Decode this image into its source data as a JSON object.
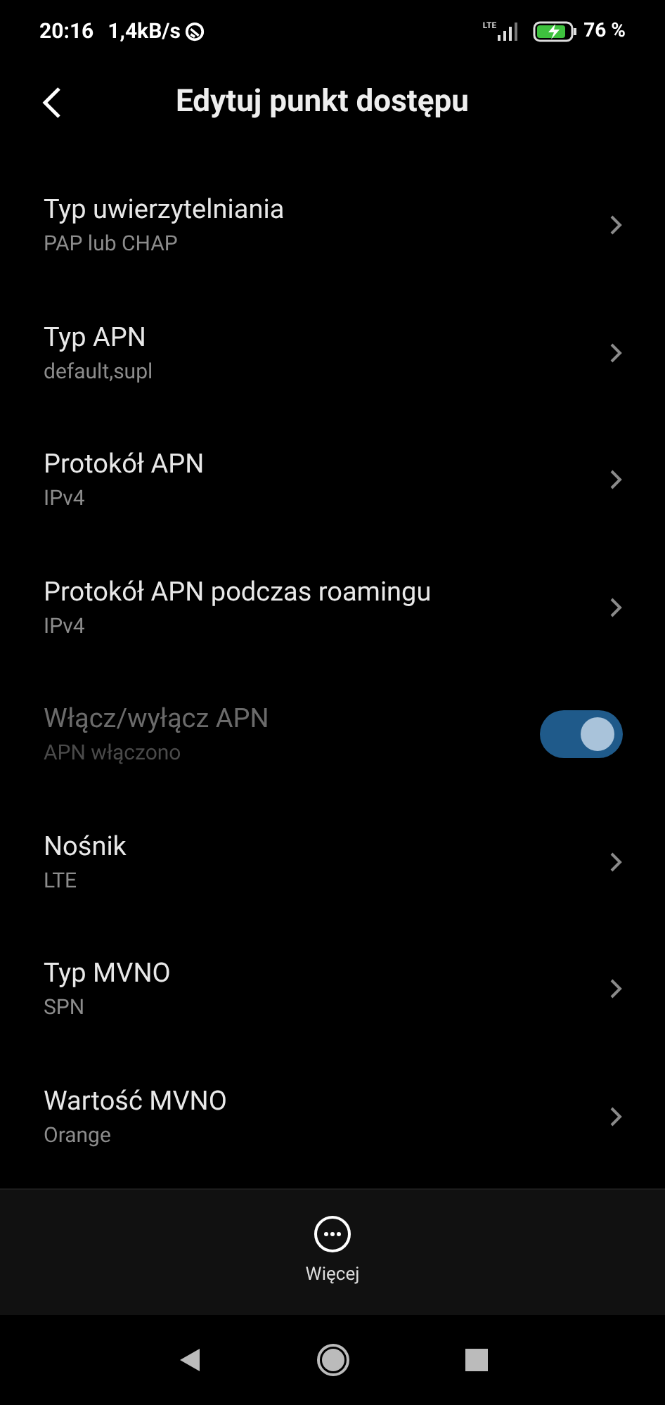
{
  "status_bar": {
    "time": "20:16",
    "speed": "1,4kB/s",
    "network_type": "LTE",
    "battery": "76 %"
  },
  "header": {
    "title": "Edytuj punkt dostępu"
  },
  "items": [
    {
      "kind": "link",
      "title": "Typ uwierzytelniania",
      "value": "PAP lub CHAP",
      "disabled": false
    },
    {
      "kind": "link",
      "title": "Typ APN",
      "value": "default,supl",
      "disabled": false
    },
    {
      "kind": "link",
      "title": "Protokół APN",
      "value": "IPv4",
      "disabled": false
    },
    {
      "kind": "link",
      "title": "Protokół APN podczas roamingu",
      "value": "IPv4",
      "disabled": false
    },
    {
      "kind": "toggle",
      "title": "Włącz/wyłącz APN",
      "value": "APN włączono",
      "disabled": true,
      "on": true
    },
    {
      "kind": "link",
      "title": "Nośnik",
      "value": "LTE",
      "disabled": false
    },
    {
      "kind": "link",
      "title": "Typ MVNO",
      "value": "SPN",
      "disabled": false
    },
    {
      "kind": "link",
      "title": "Wartość MVNO",
      "value": "Orange",
      "disabled": false
    }
  ],
  "bottom_bar": {
    "more_label": "Więcej"
  }
}
